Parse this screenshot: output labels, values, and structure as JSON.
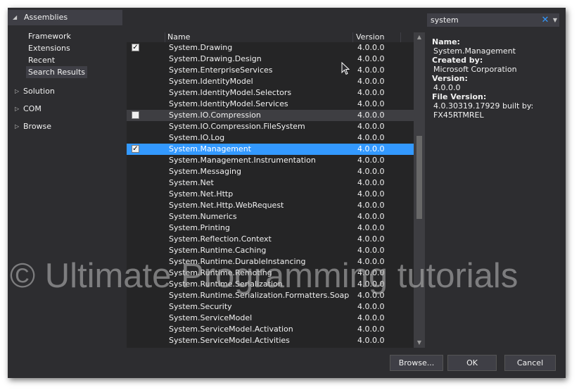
{
  "sidebar": {
    "header": "Assemblies",
    "items": [
      "Framework",
      "Extensions",
      "Recent",
      "Search Results"
    ],
    "groups": [
      "Solution",
      "COM",
      "Browse"
    ]
  },
  "list": {
    "col_name": "Name",
    "col_version": "Version",
    "rows": [
      {
        "name": "System.Drawing",
        "version": "4.0.0.0",
        "checked": true
      },
      {
        "name": "System.Drawing.Design",
        "version": "4.0.0.0"
      },
      {
        "name": "System.EnterpriseServices",
        "version": "4.0.0.0"
      },
      {
        "name": "System.IdentityModel",
        "version": "4.0.0.0"
      },
      {
        "name": "System.IdentityModel.Selectors",
        "version": "4.0.0.0"
      },
      {
        "name": "System.IdentityModel.Services",
        "version": "4.0.0.0"
      },
      {
        "name": "System.IO.Compression",
        "version": "4.0.0.0",
        "checked": false
      },
      {
        "name": "System.IO.Compression.FileSystem",
        "version": "4.0.0.0"
      },
      {
        "name": "System.IO.Log",
        "version": "4.0.0.0"
      },
      {
        "name": "System.Management",
        "version": "4.0.0.0",
        "checked": true
      },
      {
        "name": "System.Management.Instrumentation",
        "version": "4.0.0.0"
      },
      {
        "name": "System.Messaging",
        "version": "4.0.0.0"
      },
      {
        "name": "System.Net",
        "version": "4.0.0.0"
      },
      {
        "name": "System.Net.Http",
        "version": "4.0.0.0"
      },
      {
        "name": "System.Net.Http.WebRequest",
        "version": "4.0.0.0"
      },
      {
        "name": "System.Numerics",
        "version": "4.0.0.0"
      },
      {
        "name": "System.Printing",
        "version": "4.0.0.0"
      },
      {
        "name": "System.Reflection.Context",
        "version": "4.0.0.0"
      },
      {
        "name": "System.Runtime.Caching",
        "version": "4.0.0.0"
      },
      {
        "name": "System.Runtime.DurableInstancing",
        "version": "4.0.0.0"
      },
      {
        "name": "System.Runtime.Remoting",
        "version": "4.0.0.0"
      },
      {
        "name": "System.Runtime.Serialization",
        "version": "4.0.0.0"
      },
      {
        "name": "System.Runtime.Serialization.Formatters.Soap",
        "version": "4.0.0.0"
      },
      {
        "name": "System.Security",
        "version": "4.0.0.0"
      },
      {
        "name": "System.ServiceModel",
        "version": "4.0.0.0"
      },
      {
        "name": "System.ServiceModel.Activation",
        "version": "4.0.0.0"
      },
      {
        "name": "System.ServiceModel.Activities",
        "version": "4.0.0.0"
      }
    ]
  },
  "search": {
    "value": "system"
  },
  "details": {
    "name_label": "Name:",
    "name": "System.Management",
    "created_label": "Created by:",
    "created": "Microsoft Corporation",
    "version_label": "Version:",
    "version": "4.0.0.0",
    "file_version_label": "File Version:",
    "file_version_1": "4.0.30319.17929 built by:",
    "file_version_2": "FX45RTMREL"
  },
  "buttons": {
    "browse": "Browse...",
    "ok": "OK",
    "cancel": "Cancel"
  },
  "watermark": "© Ultimate Programming tutorials",
  "icons": {
    "expanded": "triangle-expanded-icon",
    "collapsed": "triangle-collapsed-icon",
    "clear": "clear-x-icon",
    "dropdown": "dropdown-arrow-icon",
    "cursor": "mouse-pointer-icon"
  },
  "colors": {
    "background": "#2d2d30",
    "list_bg": "#252526",
    "selection": "#3399ff",
    "hover": "#3e3e42"
  }
}
